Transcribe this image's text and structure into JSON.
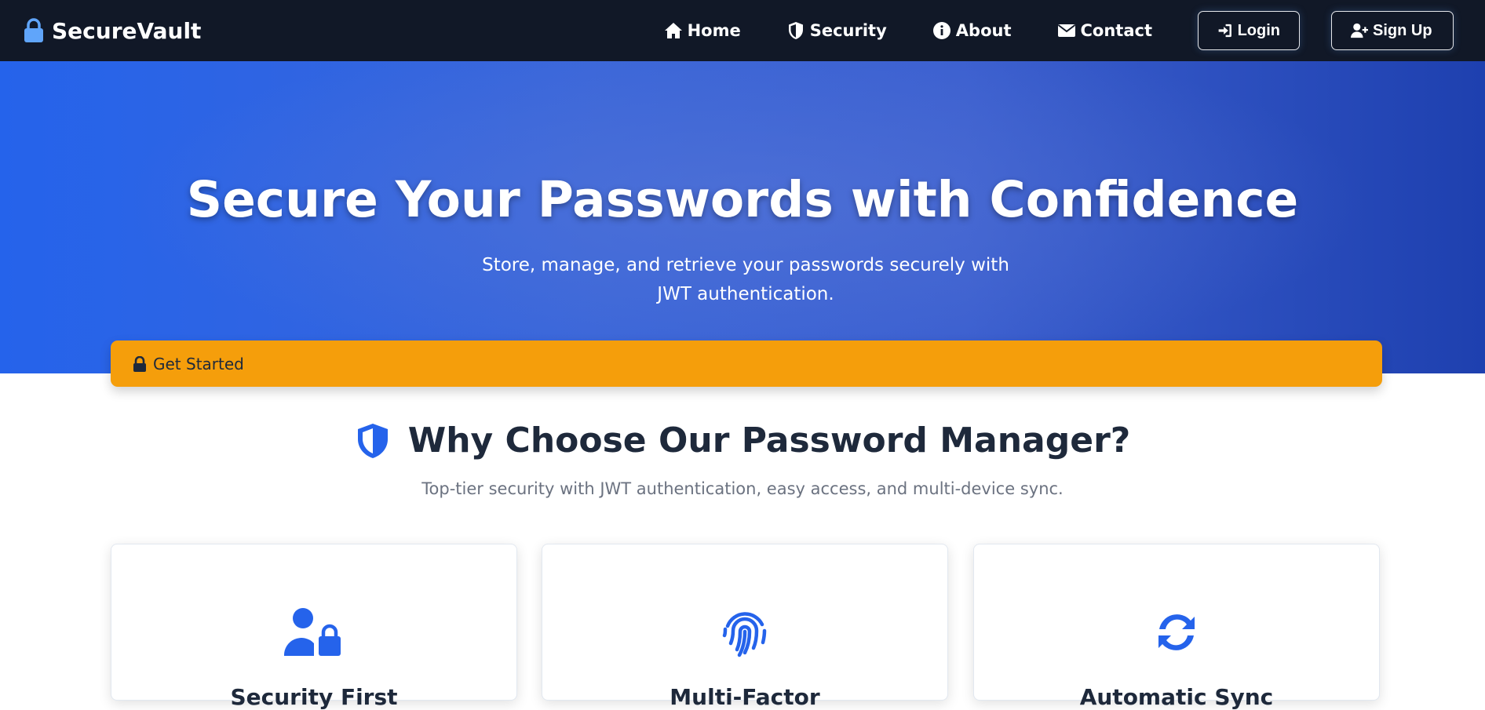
{
  "navbar": {
    "brand": "SecureVault",
    "links": [
      {
        "label": "Home",
        "icon": "home-icon"
      },
      {
        "label": "Security",
        "icon": "shield-icon"
      },
      {
        "label": "About",
        "icon": "info-icon"
      },
      {
        "label": "Contact",
        "icon": "envelope-icon"
      }
    ],
    "login_label": "Login",
    "signup_label": "Sign Up"
  },
  "hero": {
    "title": "Secure Your Passwords with Confidence",
    "subtitle": "Store, manage, and retrieve your passwords securely with JWT authentication.",
    "cta_label": "Get Started"
  },
  "features": {
    "title": "Why Choose Our Password Manager?",
    "subtitle": "Top-tier security with JWT authentication, easy access, and multi-device sync.",
    "cards": [
      {
        "icon": "user-lock-icon",
        "title": "Security First"
      },
      {
        "icon": "fingerprint-icon",
        "title": "Multi-Factor"
      },
      {
        "icon": "sync-icon",
        "title": "Automatic Sync"
      }
    ]
  },
  "colors": {
    "navbar_bg": "#111827",
    "accent": "#2563eb",
    "cta": "#f59e0b",
    "brand_icon": "#60a5fa"
  }
}
